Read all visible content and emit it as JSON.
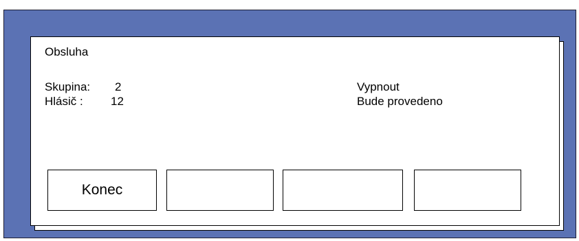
{
  "panel": {
    "title": "Obsluha",
    "group_label": "Skupina:",
    "group_value": "2",
    "detector_label": "Hlásič :",
    "detector_value": "12",
    "action": "Vypnout",
    "action_status": "Bude provedeno"
  },
  "buttons": [
    {
      "label": "Konec"
    },
    {
      "label": ""
    },
    {
      "label": ""
    },
    {
      "label": ""
    }
  ],
  "colors": {
    "background": "#5b72b4",
    "panel": "#ffffff",
    "border": "#000000"
  }
}
